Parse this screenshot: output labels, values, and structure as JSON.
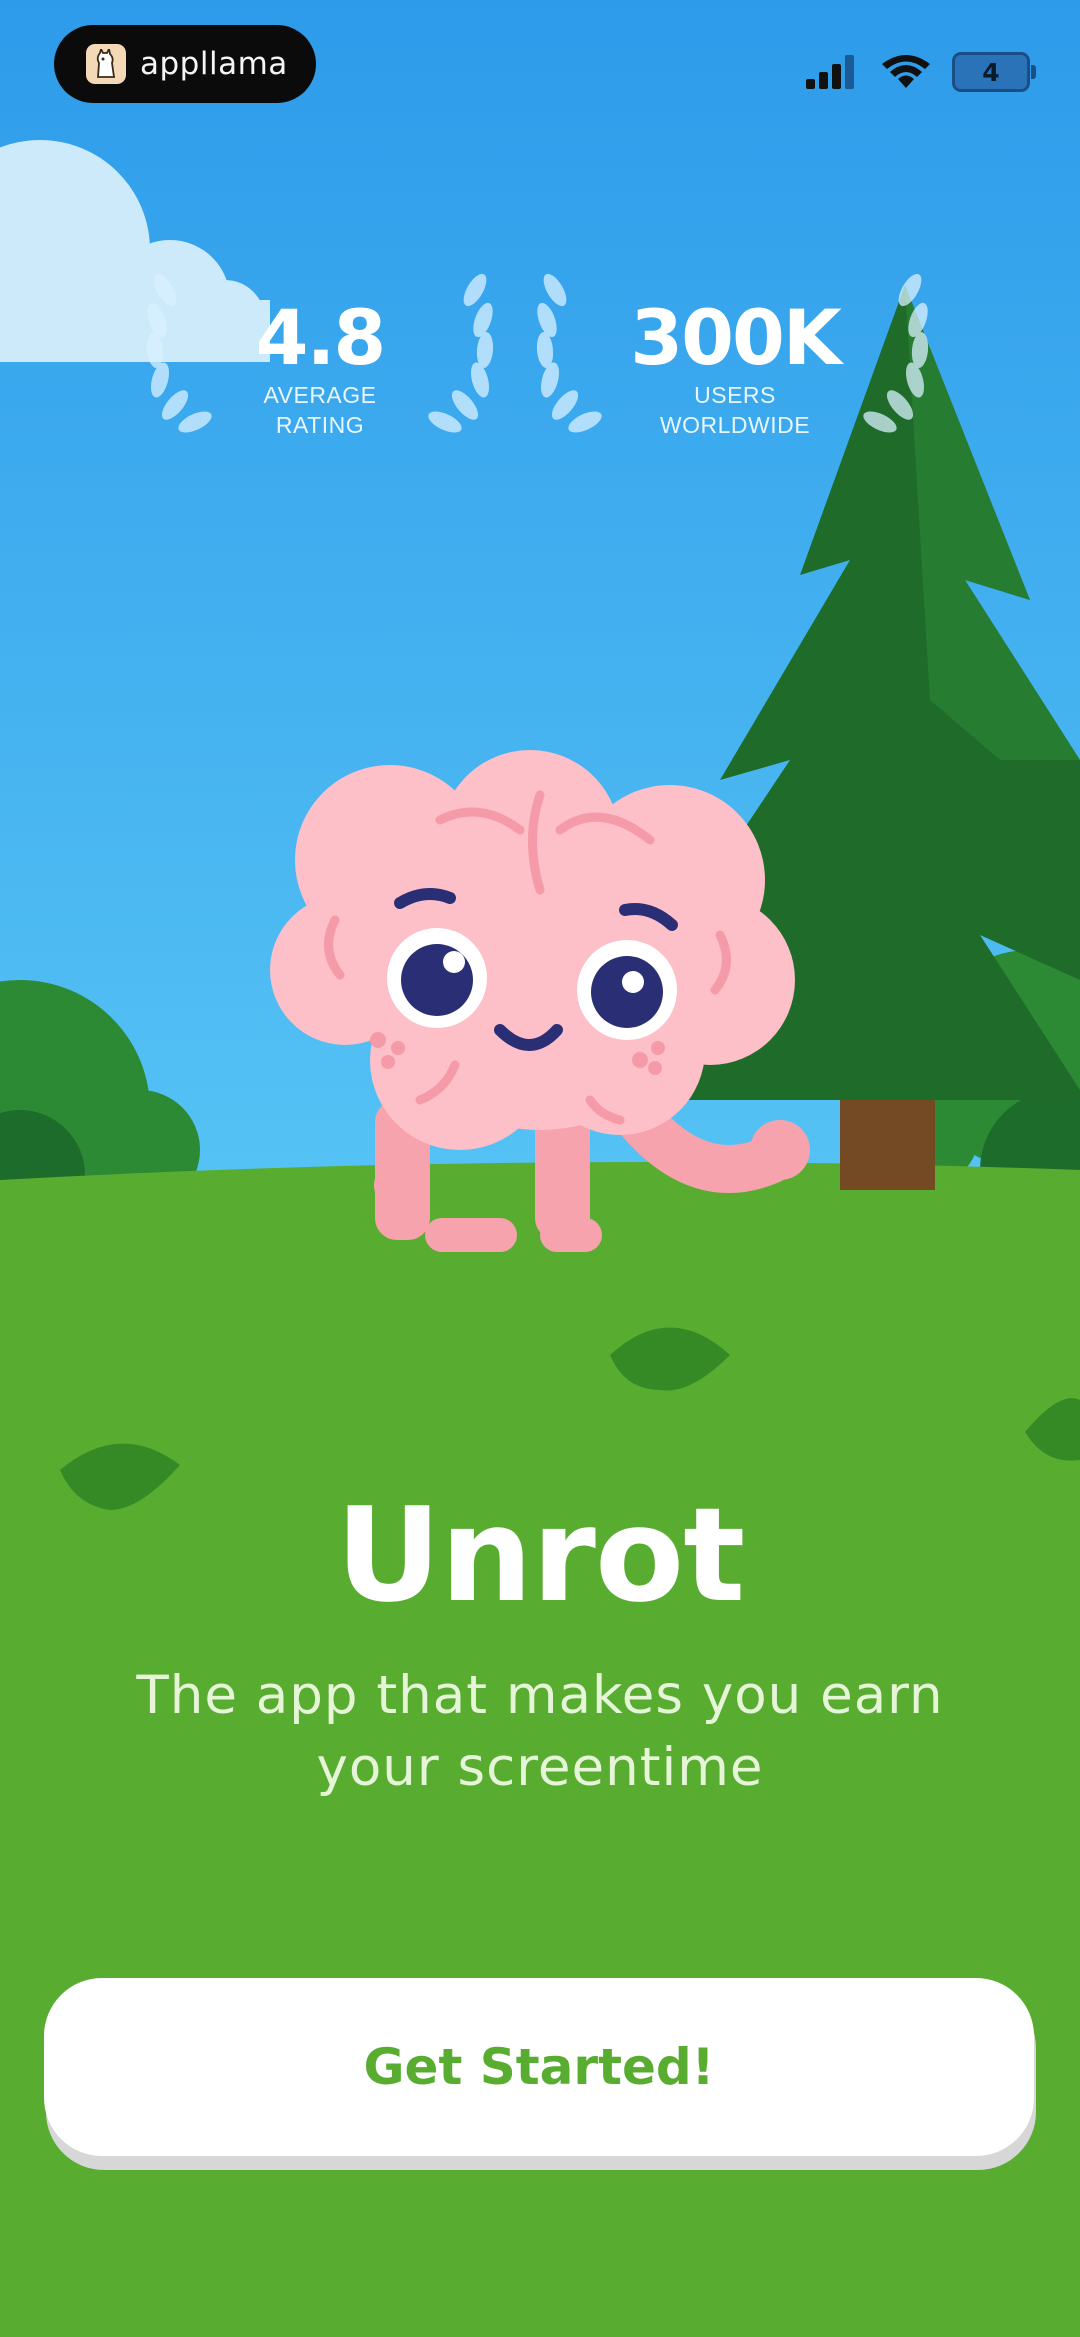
{
  "status_bar": {
    "brand": "appllama",
    "battery_level": "4"
  },
  "stats": [
    {
      "value": "4.8",
      "caption_line1": "AVERAGE",
      "caption_line2": "RATING"
    },
    {
      "value": "300K",
      "caption_line1": "USERS",
      "caption_line2": "WORLDWIDE"
    }
  ],
  "hero": {
    "title": "Unrot",
    "subtitle_line1": "The app that makes you earn",
    "subtitle_line2": "your screentime"
  },
  "cta": {
    "label": "Get Started!"
  },
  "colors": {
    "sky_top": "#2d9bea",
    "sky_bottom": "#52bff3",
    "grass": "#58ad31",
    "brain": "#fdbfc8",
    "tree": "#1e6a29",
    "cta_text": "#58ad31"
  },
  "icons": [
    "llama-logo-icon",
    "signal-icon",
    "wifi-icon",
    "battery-icon",
    "laurel-icon"
  ]
}
